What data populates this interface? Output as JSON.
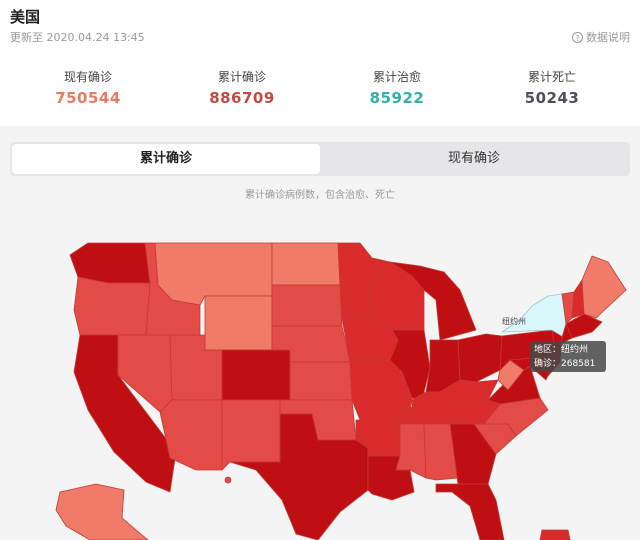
{
  "header": {
    "title": "美国",
    "updated": "更新至 2020.04.24 13:45",
    "help_label": "数据说明",
    "help_icon": "question-circle-icon"
  },
  "stats": [
    {
      "label": "现有确诊",
      "value": "750544",
      "color": "#e57b62"
    },
    {
      "label": "累计确诊",
      "value": "886709",
      "color": "#c24a42"
    },
    {
      "label": "累计治愈",
      "value": "85922",
      "color": "#2fb0a8"
    },
    {
      "label": "累计死亡",
      "value": "50243",
      "color": "#4c505a"
    }
  ],
  "tabs": [
    {
      "label": "累计确诊",
      "active": true
    },
    {
      "label": "现有确诊",
      "active": false
    }
  ],
  "map": {
    "caption": "累计确诊病例数，包含治愈、死亡",
    "highlight_label": "纽约州",
    "tooltip": {
      "region_line": "地区：纽约州",
      "count_line": "确诊：268581"
    },
    "colors": {
      "darkest": "#bf0f12",
      "dark": "#d92b2c",
      "medium": "#e34b47",
      "light": "#f07b69",
      "highlight": "#d9f6fb"
    }
  }
}
